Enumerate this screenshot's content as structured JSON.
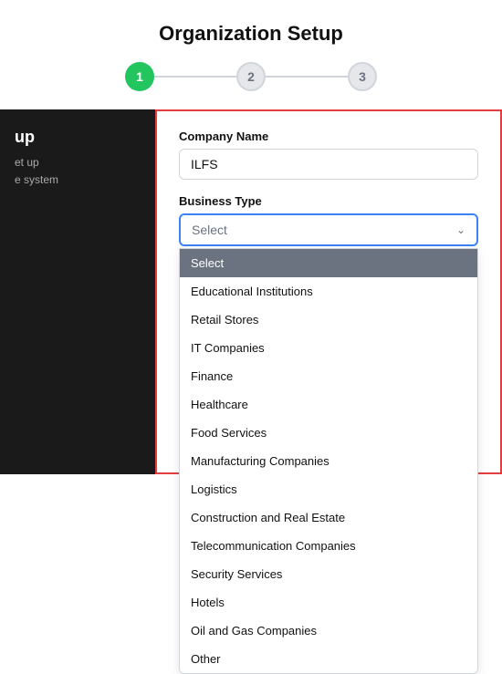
{
  "header": {
    "title": "Organization Setup"
  },
  "stepper": {
    "steps": [
      {
        "label": "1",
        "active": true
      },
      {
        "label": "2",
        "active": false
      },
      {
        "label": "3",
        "active": false
      }
    ]
  },
  "sidebar": {
    "title": "up",
    "lines": [
      "et up",
      "e system"
    ]
  },
  "form": {
    "company_name_label": "Company Name",
    "company_name_value": "ILFS",
    "company_name_placeholder": "Company Name",
    "business_type_label": "Business Type",
    "select_placeholder": "Select",
    "dropdown_options": [
      "Select",
      "Educational Institutions",
      "Retail Stores",
      "IT Companies",
      "Finance",
      "Healthcare",
      "Food Services",
      "Manufacturing Companies",
      "Logistics",
      "Construction and Real Estate",
      "Telecommunication Companies",
      "Security Services",
      "Hotels",
      "Oil and Gas Companies",
      "Other"
    ]
  }
}
